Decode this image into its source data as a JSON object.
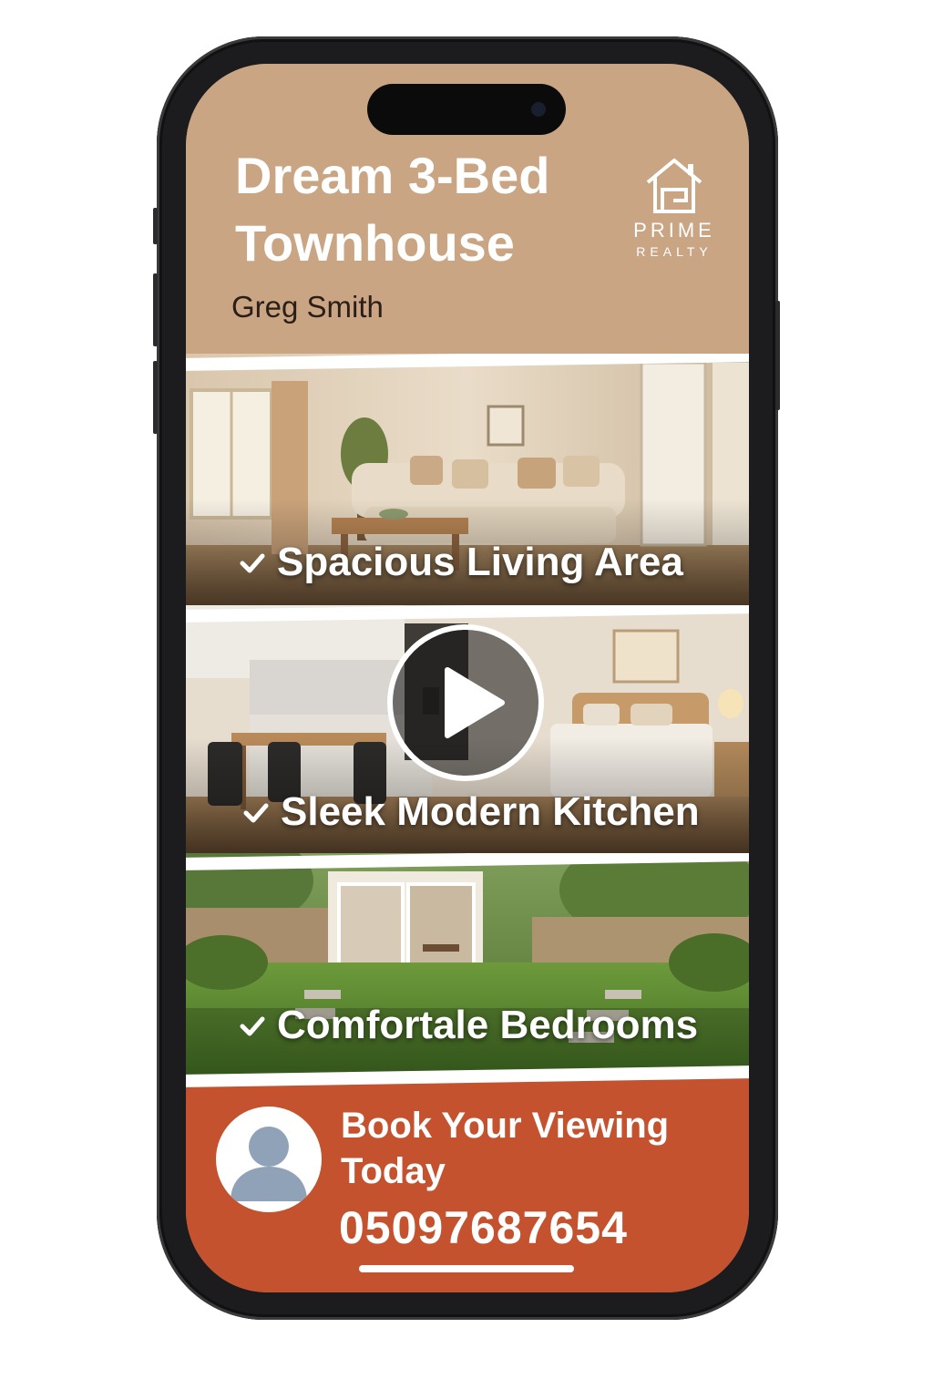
{
  "header": {
    "title": "Dream 3-Bed Townhouse",
    "agent_name": "Greg Smith"
  },
  "logo": {
    "icon": "house-icon",
    "line1": "PRIME",
    "line2": "REALTY"
  },
  "features": [
    {
      "label": "Spacious Living Area",
      "icon": "check-icon"
    },
    {
      "label": "Sleek Modern Kitchen",
      "icon": "check-icon"
    },
    {
      "label": "Comfortale Bedrooms",
      "icon": "check-icon"
    }
  ],
  "video": {
    "icon": "play-icon"
  },
  "cta": {
    "text": "Book Your Viewing Today",
    "phone": "05097687654",
    "avatar_icon": "person-icon"
  },
  "colors": {
    "header_bg": "#caa584",
    "cta_bg": "#c5522e",
    "text_light": "#ffffff"
  }
}
